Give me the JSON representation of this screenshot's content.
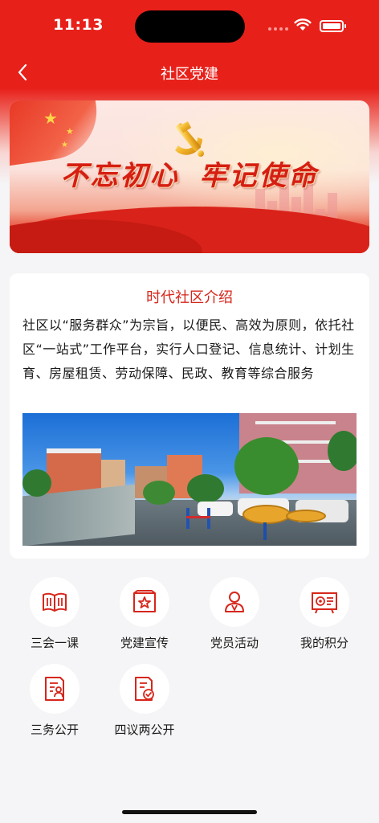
{
  "status_bar": {
    "time": "11:13"
  },
  "nav": {
    "title": "社区党建"
  },
  "banner": {
    "slogan": "不忘初心 牢记使命"
  },
  "intro": {
    "title": "时代社区介绍",
    "text": "社区以“服务群众”为宗旨，以便民、高效为原则，依托社区“一站式”工作平台，实行人口登记、信息统计、计划生育、房屋租赁、劳动保障、民政、教育等综合服务"
  },
  "menu": {
    "items": [
      {
        "label": "三会一课",
        "icon": "book-icon"
      },
      {
        "label": "党建宣传",
        "icon": "star-frame-icon"
      },
      {
        "label": "党员活动",
        "icon": "person-badge-icon"
      },
      {
        "label": "我的积分",
        "icon": "points-board-icon"
      },
      {
        "label": "三务公开",
        "icon": "document-user-icon"
      },
      {
        "label": "四议两公开",
        "icon": "document-check-icon"
      }
    ]
  },
  "colors": {
    "brand_red": "#e8201a",
    "accent_red": "#d7261b",
    "background": "#f5f5f7"
  }
}
